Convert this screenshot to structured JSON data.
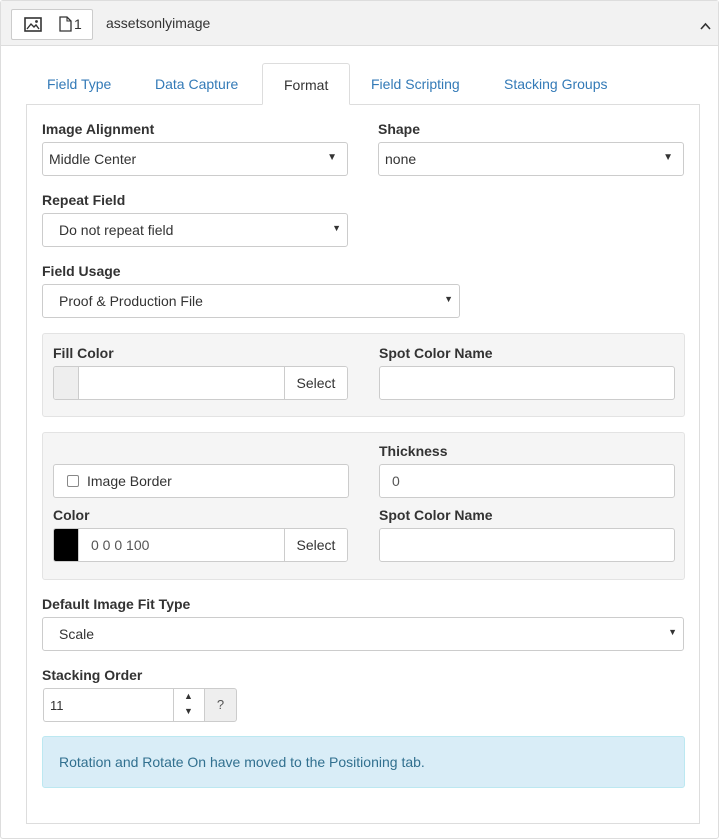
{
  "header": {
    "page_count": "1",
    "field_name": "assetsonlyimage",
    "icons": [
      "image-icon",
      "file-icon",
      "chevron-up-icon"
    ]
  },
  "tabs": [
    {
      "label": "Field Type",
      "active": false
    },
    {
      "label": "Data Capture",
      "active": false
    },
    {
      "label": "Format",
      "active": true
    },
    {
      "label": "Field Scripting",
      "active": false
    },
    {
      "label": "Stacking Groups",
      "active": false
    }
  ],
  "format": {
    "image_alignment": {
      "label": "Image Alignment",
      "value": "Middle Center"
    },
    "shape": {
      "label": "Shape",
      "value": "none"
    },
    "repeat_field": {
      "label": "Repeat Field",
      "value": "Do not repeat field"
    },
    "field_usage": {
      "label": "Field Usage",
      "value": "Proof & Production File"
    },
    "fill_color": {
      "label": "Fill Color",
      "value": "",
      "select_label": "Select",
      "swatch_color": "#eeeeee"
    },
    "fill_spot_color": {
      "label": "Spot Color Name",
      "value": ""
    },
    "image_border": {
      "label": "Image Border",
      "checked": false
    },
    "thickness": {
      "label": "Thickness",
      "value": "0"
    },
    "border_color": {
      "label": "Color",
      "value": "0 0 0 100",
      "select_label": "Select",
      "swatch_color": "#000000"
    },
    "border_spot_color": {
      "label": "Spot Color Name",
      "value": ""
    },
    "default_fit": {
      "label": "Default Image Fit Type",
      "value": "Scale"
    },
    "stacking_order": {
      "label": "Stacking Order",
      "value": "11",
      "help_label": "?"
    },
    "notice": "Rotation and Rotate On have moved to the Positioning tab."
  },
  "colors": {
    "link": "#337ab7",
    "alert_bg": "#d9edf7",
    "alert_text": "#31708f",
    "well_bg": "#f5f5f5"
  }
}
